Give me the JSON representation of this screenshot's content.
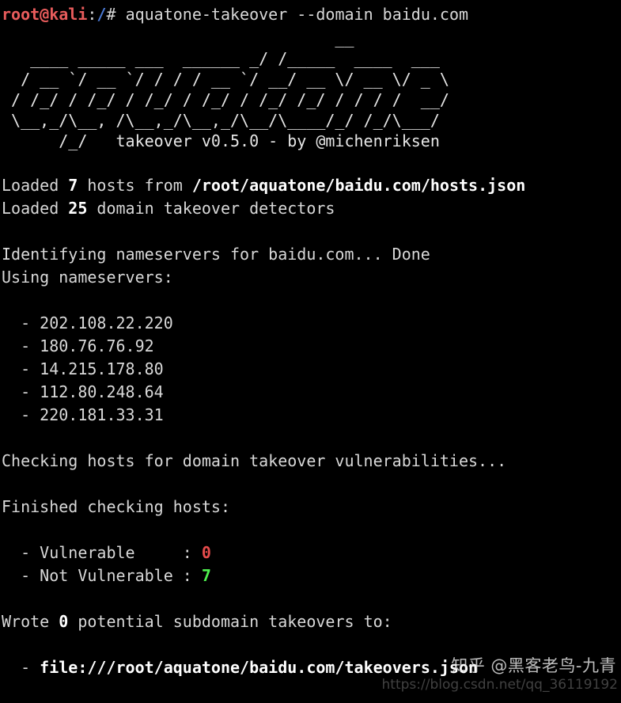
{
  "terminal": {
    "prompt": {
      "user_host": "root@kali",
      "colon": ":",
      "path": "/",
      "sigil": "# ",
      "command": "aquatone-takeover --domain baidu.com"
    },
    "banner": {
      "line1": "                                   __",
      "line2": "   ____ _____ ___  ______ _/ /_____  ____  ___",
      "line3": "  / __ `/ __ `/ / / / __ `/ __/ __ \\/ __ \\/ _ \\",
      "line4": " / /_/ / /_/ / /_/ / /_/ / /_/ /_/ / / / /  __/",
      "line5": " \\__,_/\\__, /\\__,_/\\__,_/\\__/\\____/_/ /_/\\___/",
      "line6": "      /_/   takeover v0.5.0 - by @michenriksen"
    },
    "loaded_hosts": {
      "prefix": "Loaded ",
      "count": "7",
      "middle": " hosts from ",
      "path": "/root/aquatone/baidu.com/hosts.json"
    },
    "loaded_detectors": {
      "prefix": "Loaded ",
      "count": "25",
      "suffix": " domain takeover detectors"
    },
    "identifying": "Identifying nameservers for baidu.com... Done",
    "using_nameservers_label": "Using nameservers:",
    "nameservers": [
      "202.108.22.220",
      "180.76.76.92",
      "14.215.178.80",
      "112.80.248.64",
      "220.181.33.31"
    ],
    "checking": "Checking hosts for domain takeover vulnerabilities...",
    "finished_label": "Finished checking hosts:",
    "results": [
      {
        "label": "Vulnerable",
        "padded_label": "Vulnerable     : ",
        "value": "0",
        "color": "#e74c4c"
      },
      {
        "label": "Not Vulnerable",
        "padded_label": "Not Vulnerable : ",
        "value": "7",
        "color": "#4ef04e"
      }
    ],
    "wrote": {
      "prefix": "Wrote ",
      "count": "0",
      "suffix": " potential subdomain takeovers to:"
    },
    "output_file": "file:///root/aquatone/baidu.com/takeovers.json",
    "bullet": "  - "
  },
  "watermarks": {
    "zhihu": "知乎 @黑客老鸟-九青",
    "csdn": "https://blog.csdn.net/qq_36119192"
  },
  "colors": {
    "background": "#000000",
    "foreground": "#d8d8d8",
    "prompt_user": "#e85c5c",
    "prompt_path": "#4a79d4",
    "vulnerable_red": "#e74c4c",
    "not_vulnerable_green": "#4ef04e"
  }
}
